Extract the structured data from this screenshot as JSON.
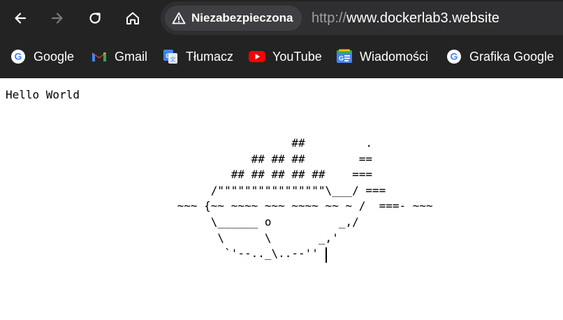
{
  "browser": {
    "security_chip": {
      "label": "Niezabezpieczona",
      "icon": "warning-triangle-icon"
    },
    "url": {
      "scheme": "http://",
      "host": "www.dockerlab3.website"
    },
    "nav": {
      "back_icon": "back-arrow-icon",
      "forward_icon": "forward-arrow-icon",
      "reload_icon": "reload-icon",
      "home_icon": "home-icon"
    },
    "bookmarks": [
      {
        "label": "Google",
        "icon": "google-icon"
      },
      {
        "label": "Gmail",
        "icon": "gmail-icon"
      },
      {
        "label": "Tłumacz",
        "icon": "translate-icon"
      },
      {
        "label": "YouTube",
        "icon": "youtube-icon"
      },
      {
        "label": "Wiadomości",
        "icon": "news-icon"
      },
      {
        "label": "Grafika Google",
        "icon": "google-icon"
      }
    ]
  },
  "page": {
    "hello_text": "Hello World",
    "ascii_art": "                  ##         .\n            ## ## ##        ==\n         ## ## ## ## ##    ===\n      /\"\"\"\"\"\"\"\"\"\"\"\"\"\"\"\"\\___/ ===\n ~~~ {~~ ~~~~ ~~~ ~~~~ ~~ ~ /  ===- ~~~\n      \\______ o          _,/\n       \\      \\       _,'\n        `'--.._\\..--''"
  },
  "colors": {
    "chrome_bg": "#232323",
    "omnibox_bg": "#2f2f31",
    "chip_bg": "#3f3f43",
    "text_light": "#ffffff",
    "url_scheme": "#9aa0a6",
    "page_bg": "#ffffff"
  }
}
